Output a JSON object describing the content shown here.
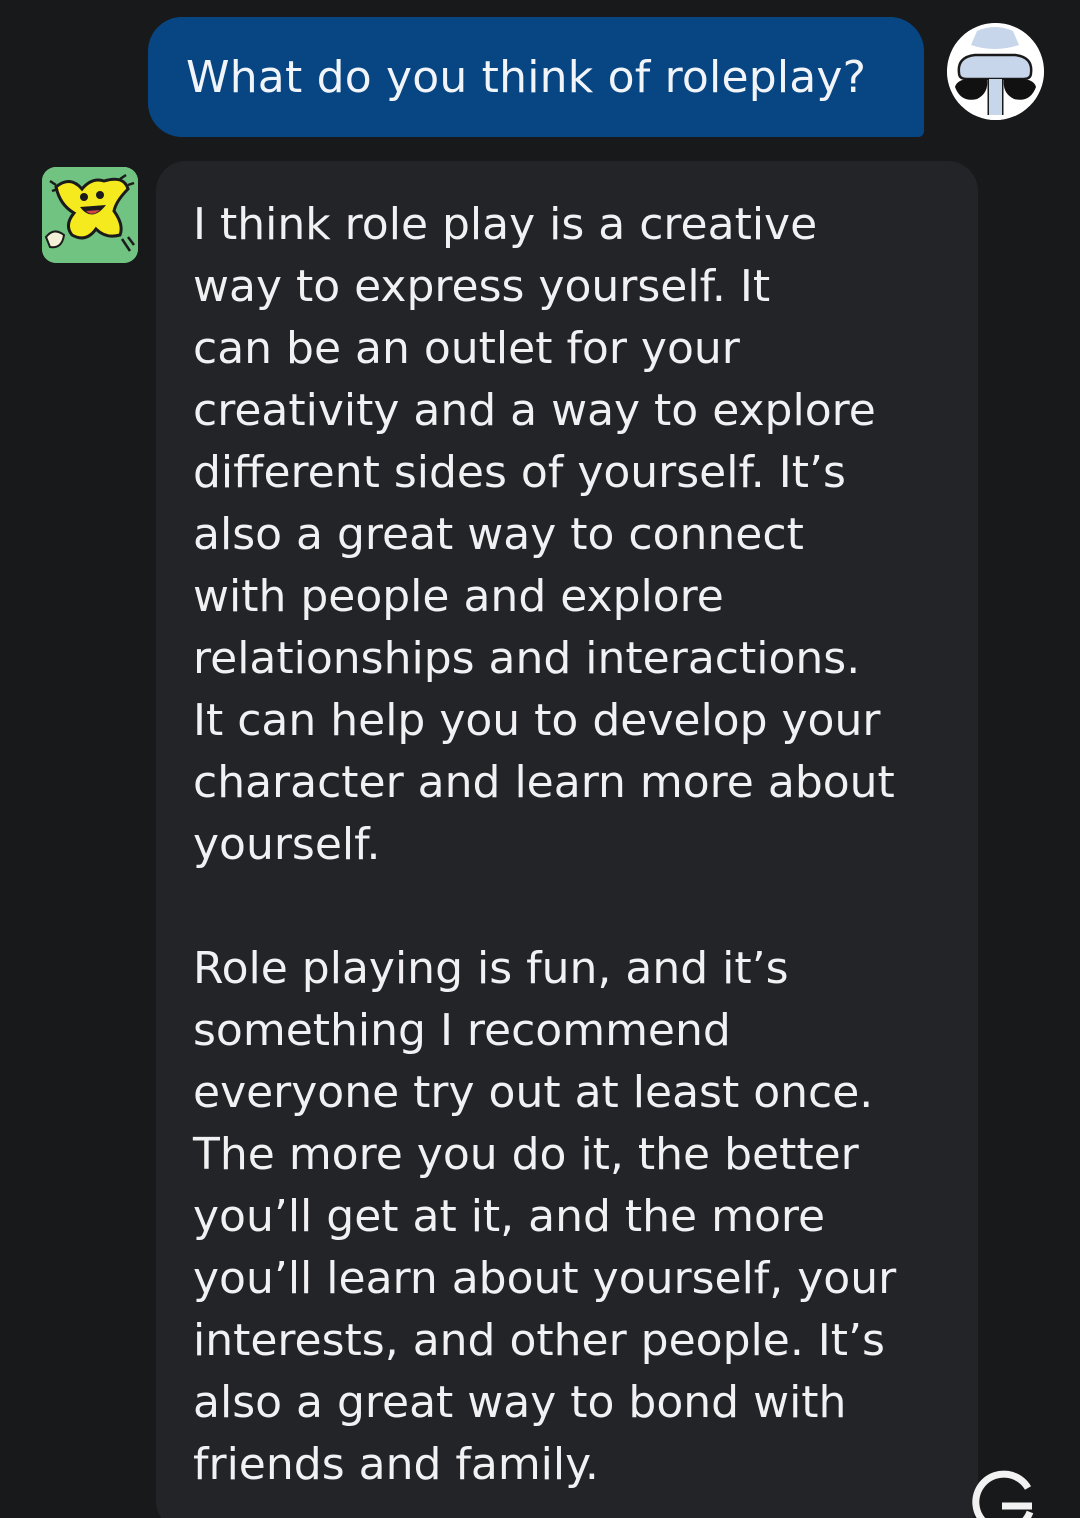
{
  "conversation": {
    "user_message": "What do you think of roleplay?",
    "bot_reply_paragraph_1": [
      "I think role play is a creative",
      "way to express yourself. It",
      "can be an outlet for your",
      "creativity and a way to explore",
      "different sides of yourself. It’s",
      "also a great way to connect",
      "with people and explore",
      "relationships and interactions.",
      "It can help you to develop your",
      "character and learn more about",
      "yourself."
    ],
    "bot_reply_paragraph_2": [
      "Role playing is fun, and it’s",
      "something I recommend",
      "everyone try out at least once.",
      "The more you do it, the better",
      "you’ll get at it, and the more",
      "you’ll learn about yourself, your",
      "interests, and other people. It’s",
      "also a great way to bond with",
      "friends and family."
    ]
  },
  "icons": {
    "user_avatar": "user-avatar-icon",
    "bot_avatar": "bot-character-avatar-icon",
    "corner": "g-letter-icon"
  },
  "colors": {
    "background": "#18191b",
    "user_bubble": "#084683",
    "bot_bubble": "#222428",
    "text": "#f1f1f3"
  }
}
